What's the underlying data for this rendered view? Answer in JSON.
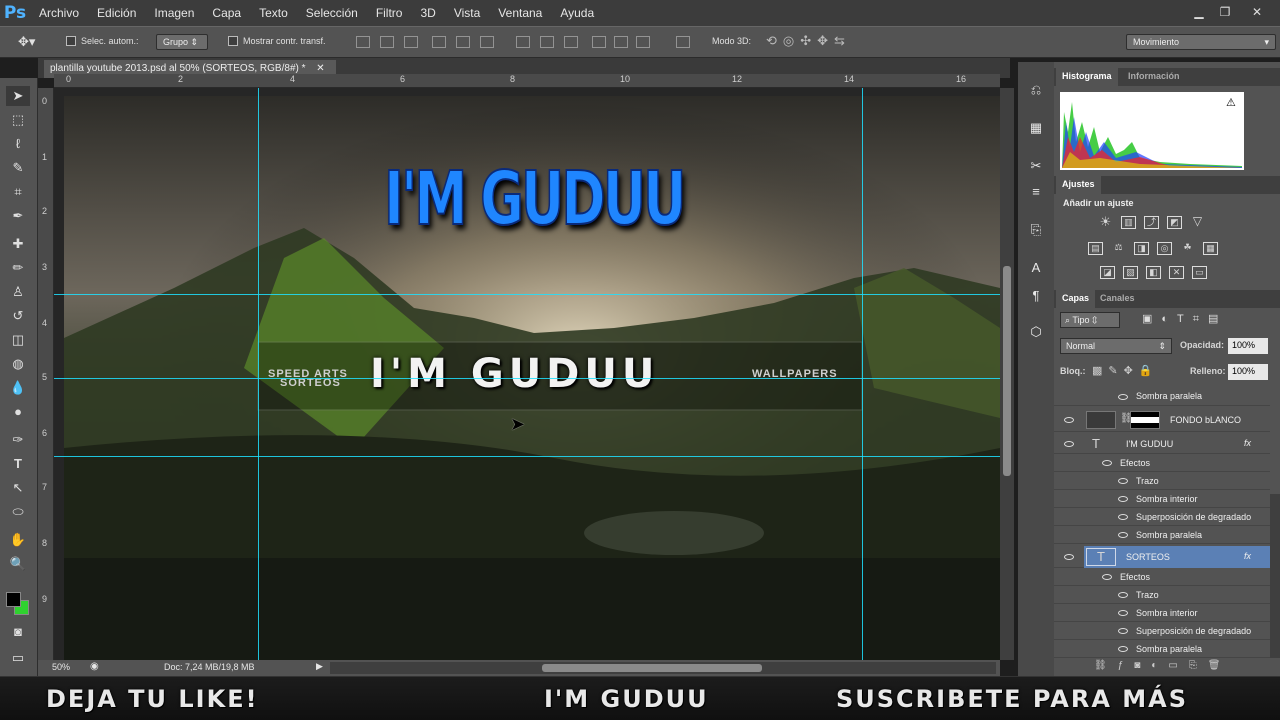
{
  "menubar": {
    "logo": "Ps",
    "items": [
      "Archivo",
      "Edición",
      "Imagen",
      "Capa",
      "Texto",
      "Selección",
      "Filtro",
      "3D",
      "Vista",
      "Ventana",
      "Ayuda"
    ]
  },
  "options": {
    "auto_select": "Selec. autom.:",
    "group": "Grupo",
    "show_transform": "Mostrar contr. transf.",
    "mode3d": "Modo 3D:",
    "workspace": "Movimiento"
  },
  "document": {
    "tab_title": "plantilla youtube 2013.psd al 50% (SORTEOS, RGB/8#) *",
    "ruler_top": [
      "0",
      "2",
      "4",
      "6",
      "8",
      "10",
      "12",
      "14",
      "16"
    ],
    "ruler_left": [
      "0",
      "1",
      "2",
      "3",
      "4",
      "5",
      "6",
      "7",
      "8",
      "9"
    ]
  },
  "artwork": {
    "title_blue": "I'M GUDUU",
    "left_top": "SPEED ARTS",
    "left_bottom": "SORTEOS",
    "center": "I'M GUDUU",
    "right": "WALLPAPERS"
  },
  "status": {
    "zoom": "50%",
    "doc": "Doc: 7,24 MB/19,8 MB"
  },
  "panels": {
    "histogram_tab": "Histograma",
    "info_tab": "Información",
    "adjustments_tab": "Ajustes",
    "add_adjustment": "Añadir un ajuste",
    "layers_tab": "Capas",
    "channels_tab": "Canales",
    "filter_kind": "Tipo",
    "blend_mode": "Normal",
    "opacity_label": "Opacidad:",
    "opacity_value": "100%",
    "lock_label": "Bloq.:",
    "fill_label": "Relleno:",
    "fill_value": "100%"
  },
  "layers": [
    {
      "type": "effect",
      "label": "Sombra paralela",
      "indent": 1
    },
    {
      "type": "layer",
      "label": "FONDO bLANCO",
      "kind": "image"
    },
    {
      "type": "layer",
      "label": "I'M GUDUU",
      "kind": "text",
      "fx": "fx"
    },
    {
      "type": "effects",
      "label": "Efectos"
    },
    {
      "type": "effect",
      "label": "Trazo",
      "indent": 1
    },
    {
      "type": "effect",
      "label": "Sombra interior",
      "indent": 1
    },
    {
      "type": "effect",
      "label": "Superposición de degradado",
      "indent": 1
    },
    {
      "type": "effect",
      "label": "Sombra paralela",
      "indent": 1
    },
    {
      "type": "layer",
      "label": "SORTEOS",
      "kind": "text",
      "fx": "fx",
      "selected": true
    },
    {
      "type": "effects",
      "label": "Efectos"
    },
    {
      "type": "effect",
      "label": "Trazo",
      "indent": 1
    },
    {
      "type": "effect",
      "label": "Sombra interior",
      "indent": 1
    },
    {
      "type": "effect",
      "label": "Superposición de degradado",
      "indent": 1
    },
    {
      "type": "effect",
      "label": "Sombra paralela",
      "indent": 1
    }
  ],
  "banner": {
    "left": "DEJA TU LIKE!",
    "center": "I'M GUDUU",
    "right": "SUSCRIBETE PARA MÁS"
  },
  "colors": {
    "accent_blue": "#1e90ff",
    "guide": "#1ee0ff",
    "selected_layer": "#5b80b5",
    "foreground": "#000000",
    "background": "#2fd12f"
  }
}
